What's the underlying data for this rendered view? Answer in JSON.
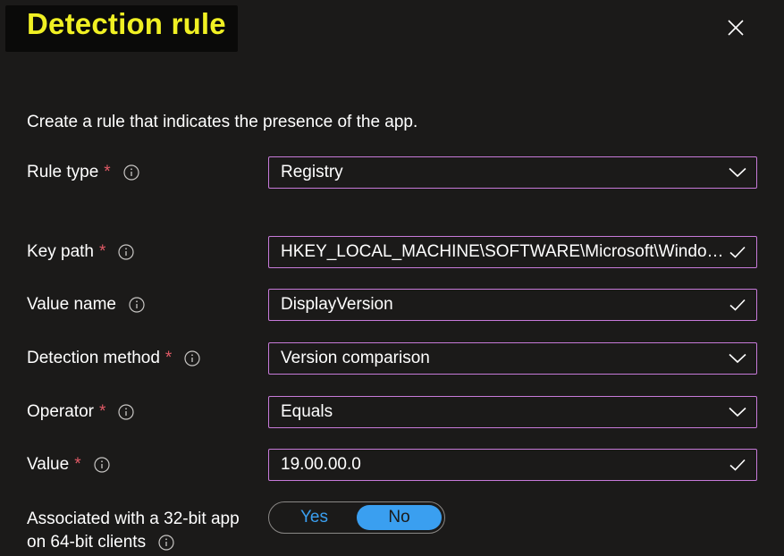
{
  "header": {
    "title": "Detection rule",
    "close_icon": "close-icon"
  },
  "description": "Create a rule that indicates the presence of the app.",
  "colors": {
    "title_highlight": "#f0f023",
    "required": "#e05a66",
    "field_border": "#c77ad9",
    "toggle_accent": "#3a9ff0"
  },
  "form": {
    "rule_type": {
      "label": "Rule type",
      "required_mark": "*",
      "value": "Registry",
      "control": "dropdown"
    },
    "key_path": {
      "label": "Key path",
      "required_mark": "*",
      "value": "HKEY_LOCAL_MACHINE\\SOFTWARE\\Microsoft\\Windows...",
      "control": "validated-text"
    },
    "value_name": {
      "label": "Value name",
      "value": "DisplayVersion",
      "control": "validated-text"
    },
    "detection_method": {
      "label": "Detection method",
      "required_mark": "*",
      "value": "Version comparison",
      "control": "dropdown"
    },
    "operator": {
      "label": "Operator",
      "required_mark": "*",
      "value": "Equals",
      "control": "dropdown"
    },
    "value": {
      "label": "Value",
      "required_mark": "*",
      "value": "19.00.00.0",
      "control": "validated-text"
    },
    "associated_32bit": {
      "label_line1": "Associated with a 32-bit app",
      "label_line2": "on 64-bit clients",
      "options": [
        "Yes",
        "No"
      ],
      "selected": "No"
    }
  }
}
